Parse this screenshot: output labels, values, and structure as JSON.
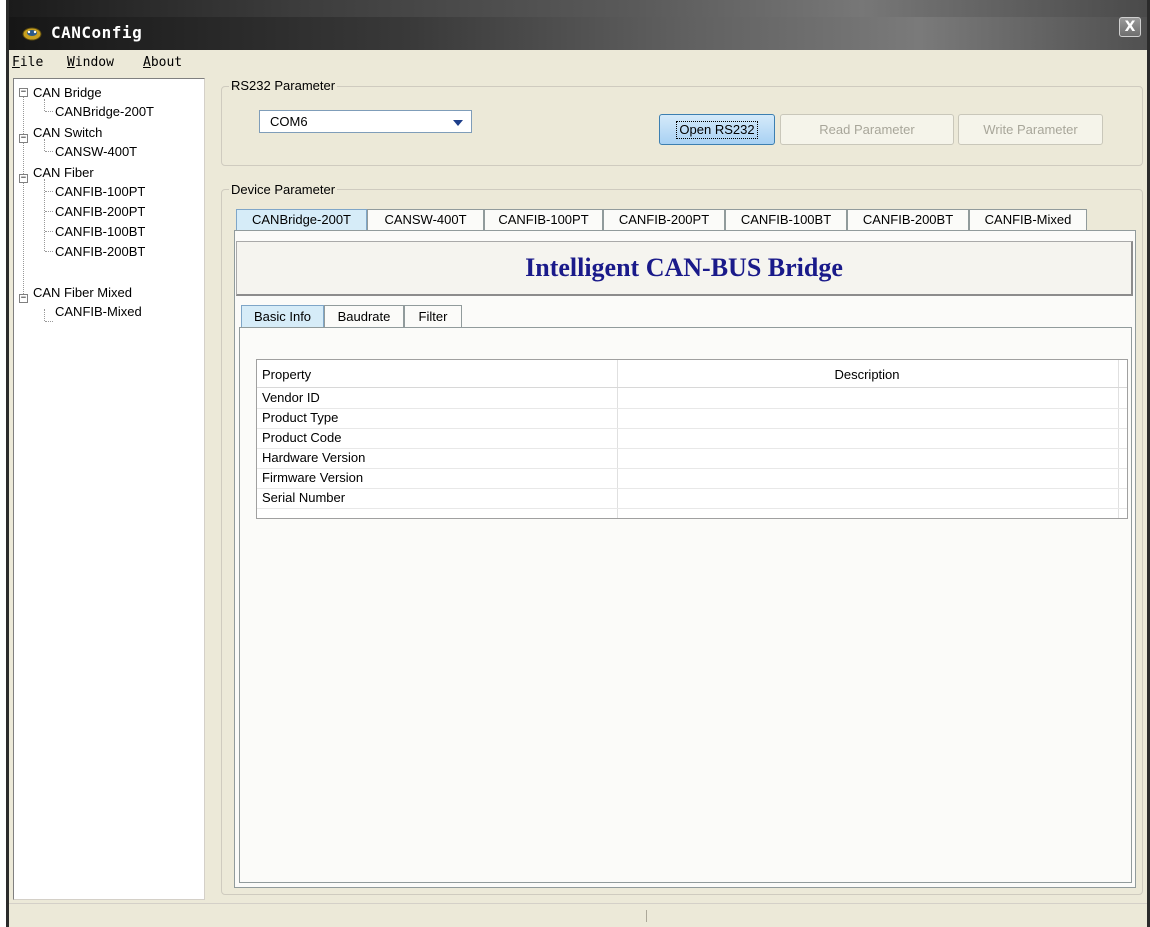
{
  "window": {
    "title": "CANConfig",
    "close_glyph": "X",
    "icon": "app-logo-icon"
  },
  "menu": [
    {
      "accel": "F",
      "rest": "ile"
    },
    {
      "accel": "W",
      "rest": "indow"
    },
    {
      "accel": "A",
      "rest": "bout"
    }
  ],
  "tree": {
    "groups": [
      {
        "label": "CAN Bridge",
        "expander": "−",
        "children": [
          "CANBridge-200T"
        ]
      },
      {
        "label": "CAN Switch",
        "expander": "−",
        "children": [
          "CANSW-400T"
        ]
      },
      {
        "label": "CAN Fiber",
        "expander": "−",
        "children": [
          "CANFIB-100PT",
          "CANFIB-200PT",
          "CANFIB-100BT",
          "CANFIB-200BT"
        ]
      },
      {
        "label": "CAN Fiber Mixed",
        "expander": "−",
        "children": [
          "CANFIB-Mixed"
        ]
      }
    ]
  },
  "rs232": {
    "group_label": "RS232 Parameter",
    "port_value": "COM6",
    "open_label": "Open RS232",
    "read_label": "Read Parameter",
    "write_label": "Write Parameter"
  },
  "device": {
    "group_label": "Device Parameter",
    "tabs": [
      "CANBridge-200T",
      "CANSW-400T",
      "CANFIB-100PT",
      "CANFIB-200PT",
      "CANFIB-100BT",
      "CANFIB-200BT",
      "CANFIB-Mixed"
    ],
    "active_tab": 0,
    "banner_title": "Intelligent CAN-BUS Bridge",
    "subtabs": [
      "Basic Info",
      "Baudrate",
      "Filter"
    ],
    "active_subtab": 0,
    "table": {
      "columns": [
        "Property",
        "Description"
      ],
      "rows": [
        {
          "property": "Vendor ID",
          "description": ""
        },
        {
          "property": "Product Type",
          "description": ""
        },
        {
          "property": "Product Code",
          "description": ""
        },
        {
          "property": "Hardware Version",
          "description": ""
        },
        {
          "property": "Firmware Version",
          "description": ""
        },
        {
          "property": "Serial Number",
          "description": ""
        }
      ]
    }
  },
  "colors": {
    "banner_title": "#1a1a8a",
    "active_tab": "#d6ecf8",
    "titlebar_dark": "#1b1b1b"
  }
}
